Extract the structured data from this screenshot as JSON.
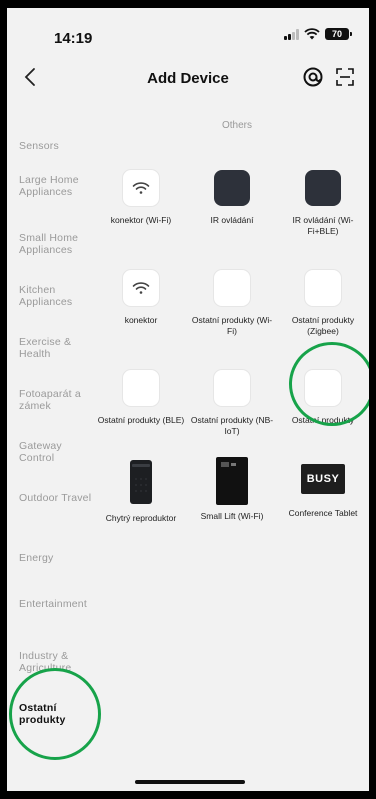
{
  "status": {
    "time": "14:19",
    "battery": "70"
  },
  "header": {
    "title": "Add Device"
  },
  "sidebar": {
    "items": [
      {
        "label": "Sensors"
      },
      {
        "label": "Large Home Appliances"
      },
      {
        "label": "Small Home Appliances"
      },
      {
        "label": "Kitchen Appliances"
      },
      {
        "label": "Exercise & Health"
      },
      {
        "label": "Fotoaparát a zámek"
      },
      {
        "label": "Gateway Control"
      },
      {
        "label": "Outdoor Travel"
      },
      {
        "label": "Energy"
      },
      {
        "label": "Entertainment"
      },
      {
        "label": "Industry & Agriculture"
      },
      {
        "label": "Ostatní produkty"
      }
    ]
  },
  "main": {
    "section_title": "Others",
    "products": [
      {
        "label": "konektor (Wi-Fi)",
        "thumb": "wifi-icon"
      },
      {
        "label": "IR ovládání",
        "thumb": "dark-box"
      },
      {
        "label": "IR ovládání (Wi-Fi+BLE)",
        "thumb": "dark-box"
      },
      {
        "label": "konektor",
        "thumb": "wifi-icon"
      },
      {
        "label": "Ostatní produkty (Wi-Fi)",
        "thumb": "white-box"
      },
      {
        "label": "Ostatní produkty (Zigbee)",
        "thumb": "white-box"
      },
      {
        "label": "Ostatní produkty (BLE)",
        "thumb": "white-box"
      },
      {
        "label": "Ostatní produkty (NB-IoT)",
        "thumb": "white-box"
      },
      {
        "label": "Ostatní produkty",
        "thumb": "white-box"
      },
      {
        "label": "Chytrý reproduktor",
        "thumb": "speaker"
      },
      {
        "label": "Small Lift (Wi-Fi)",
        "thumb": "lift"
      },
      {
        "label": "Conference Tablet",
        "thumb": "busy-sign"
      }
    ],
    "busy_text": "BUSY"
  },
  "colors": {
    "annotation": "#17a34a",
    "background": "#f2f2f2",
    "active_text": "#111111"
  }
}
